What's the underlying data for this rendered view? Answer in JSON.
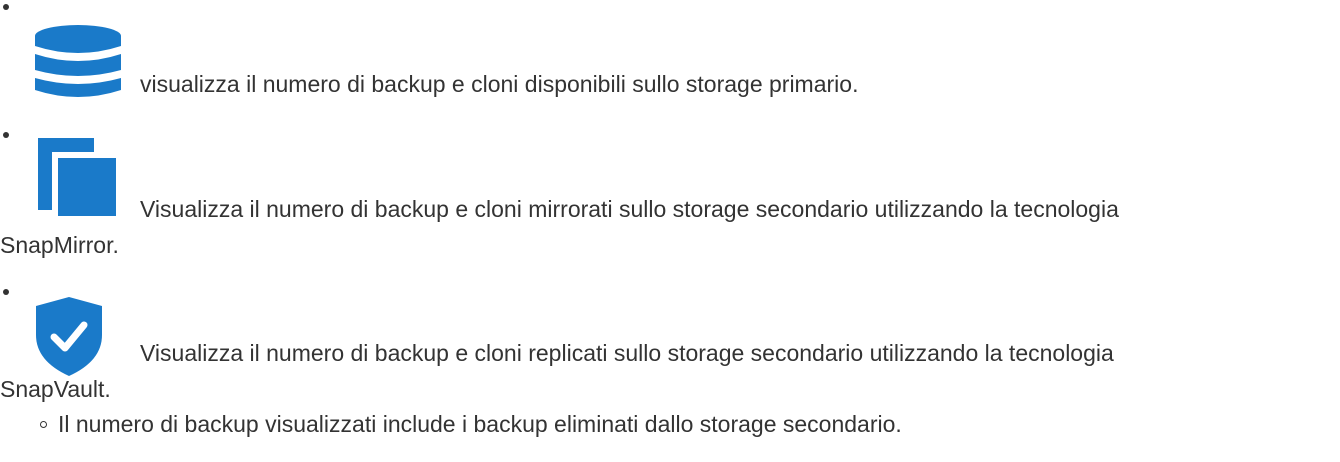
{
  "items": [
    {
      "icon": "database-icon",
      "text": "visualizza il numero di backup e cloni disponibili sullo storage primario."
    },
    {
      "icon": "copy-icon",
      "text_line1": "Visualizza il numero di backup e cloni mirrorati sullo storage secondario utilizzando la tecnologia",
      "text_line2": "SnapMirror."
    },
    {
      "icon": "shield-check-icon",
      "text_line1": "Visualizza il numero di backup e cloni replicati sullo storage secondario utilizzando la tecnologia",
      "text_line2": "SnapVault.",
      "subitems": [
        "Il numero di backup visualizzati include i backup eliminati dallo storage secondario."
      ]
    }
  ],
  "colors": {
    "icon_blue": "#1a7ac9",
    "text": "#333333"
  }
}
